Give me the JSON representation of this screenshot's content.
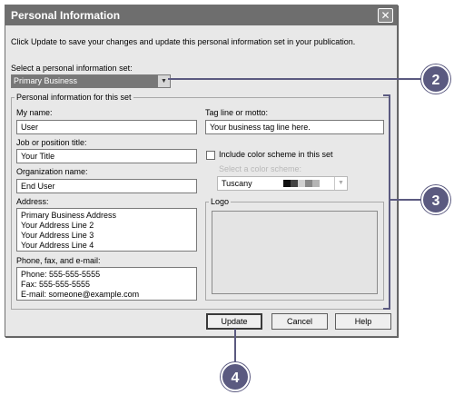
{
  "dialog": {
    "title": "Personal Information",
    "close_glyph": "✕",
    "instruction": "Click Update to save your changes and update this personal information set in your publication."
  },
  "set_selector": {
    "label": "Select a personal information set:",
    "value": "Primary Business",
    "arrow": "▼"
  },
  "group": {
    "legend": "Personal information for this set",
    "name_label": "My name:",
    "name_value": "User",
    "job_label": "Job or position title:",
    "job_value": "Your Title",
    "org_label": "Organization name:",
    "org_value": "End User",
    "address_label": "Address:",
    "address_lines": [
      "Primary Business Address",
      "Your Address Line 2",
      "Your Address Line 3",
      "Your Address Line 4"
    ],
    "phone_label": "Phone, fax, and e-mail:",
    "phone_lines": [
      "Phone: 555-555-5555",
      "Fax: 555-555-5555",
      "E-mail: someone@example.com"
    ],
    "tagline_label": "Tag line or motto:",
    "tagline_value": "Your business tag line here.",
    "color_checkbox_label": "Include color scheme in this set",
    "color_scheme_label": "Select a color scheme:",
    "color_scheme_value": "Tuscany",
    "color_scheme_arrow": "▼",
    "logo_legend": "Logo"
  },
  "buttons": {
    "update": "Update",
    "cancel": "Cancel",
    "help": "Help"
  },
  "callouts": {
    "c2": "2",
    "c3": "3",
    "c4": "4",
    "color": "#5b5a80"
  },
  "swatch_colors": [
    "#111111",
    "#444444",
    "#888888",
    "#b5b5b5",
    "#d0d0d0"
  ]
}
